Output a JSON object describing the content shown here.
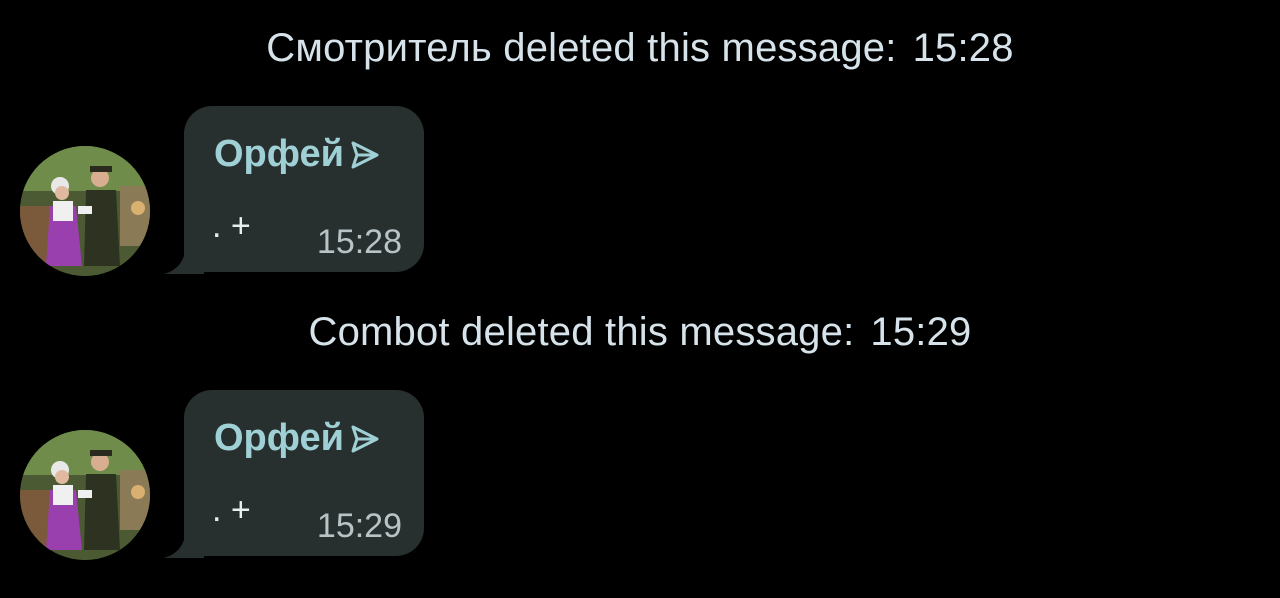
{
  "service_messages": [
    {
      "text": "Смотритель deleted this message:",
      "time": "15:28"
    },
    {
      "text": "Combot deleted this message:",
      "time": "15:29"
    }
  ],
  "messages": [
    {
      "sender": "Орфей",
      "sender_icon": "send-arrow-icon",
      "text": ". +",
      "time": "15:28"
    },
    {
      "sender": "Орфей",
      "sender_icon": "send-arrow-icon",
      "text": ". +",
      "time": "15:29"
    }
  ],
  "colors": {
    "background": "#000000",
    "bubble": "#28302f",
    "sender_name": "#9fd0d6",
    "service_text": "#d7e3ea"
  }
}
